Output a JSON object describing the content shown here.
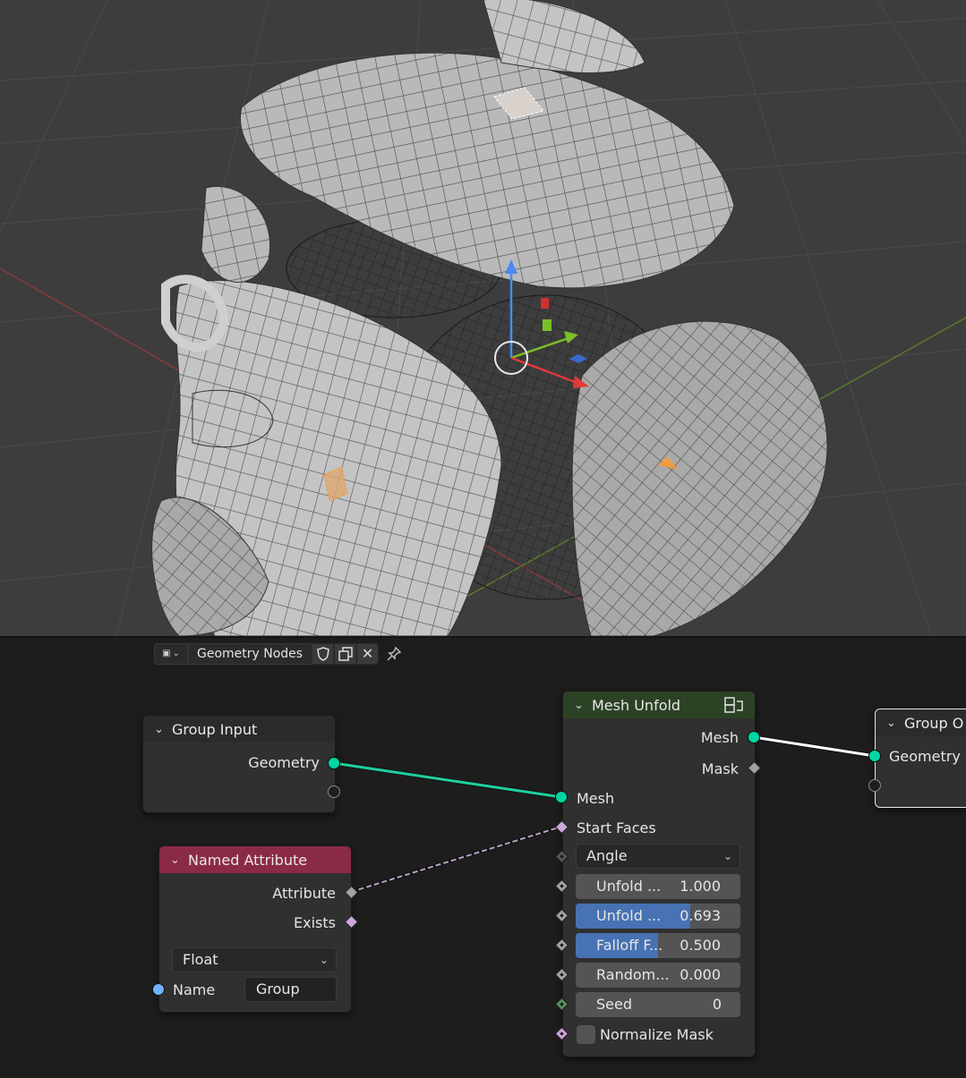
{
  "node_editor": {
    "tree_name": "Geometry Nodes"
  },
  "colors": {
    "geometry_socket": "#00d6a3",
    "field_socket": "#cca6d6",
    "float_socket": "#a1a1a1",
    "int_socket": "#598c5c",
    "string_socket": "#70b2ff",
    "input_header": "#2b2b2b",
    "geometry_header": "#2c4225",
    "attribute_header": "#8b2a45",
    "slider_fill": "#4772b3"
  },
  "nodes": {
    "group_input": {
      "title": "Group Input",
      "outputs": [
        "Geometry"
      ]
    },
    "named_attribute": {
      "title": "Named Attribute",
      "outputs": [
        "Attribute",
        "Exists"
      ],
      "data_type": "Float",
      "name_label": "Name",
      "name_value": "Group"
    },
    "mesh_unfold": {
      "title": "Mesh Unfold",
      "outputs": [
        "Mesh",
        "Mask"
      ],
      "inputs": [
        "Mesh",
        "Start Faces"
      ],
      "mode": "Angle",
      "fields": [
        {
          "label": "Unfold ...",
          "value": "1.000",
          "fill": 0
        },
        {
          "label": "Unfold ...",
          "value": "0.693",
          "fill": 0.693
        },
        {
          "label": "Falloff F...",
          "value": "0.500",
          "fill": 0.5
        },
        {
          "label": "Random...",
          "value": "0.000",
          "fill": 0
        },
        {
          "label": "Seed",
          "value": "0",
          "fill": 0
        }
      ],
      "normalize_label": "Normalize Mask"
    },
    "group_output": {
      "title": "Group O",
      "inputs": [
        "Geometry"
      ]
    }
  }
}
